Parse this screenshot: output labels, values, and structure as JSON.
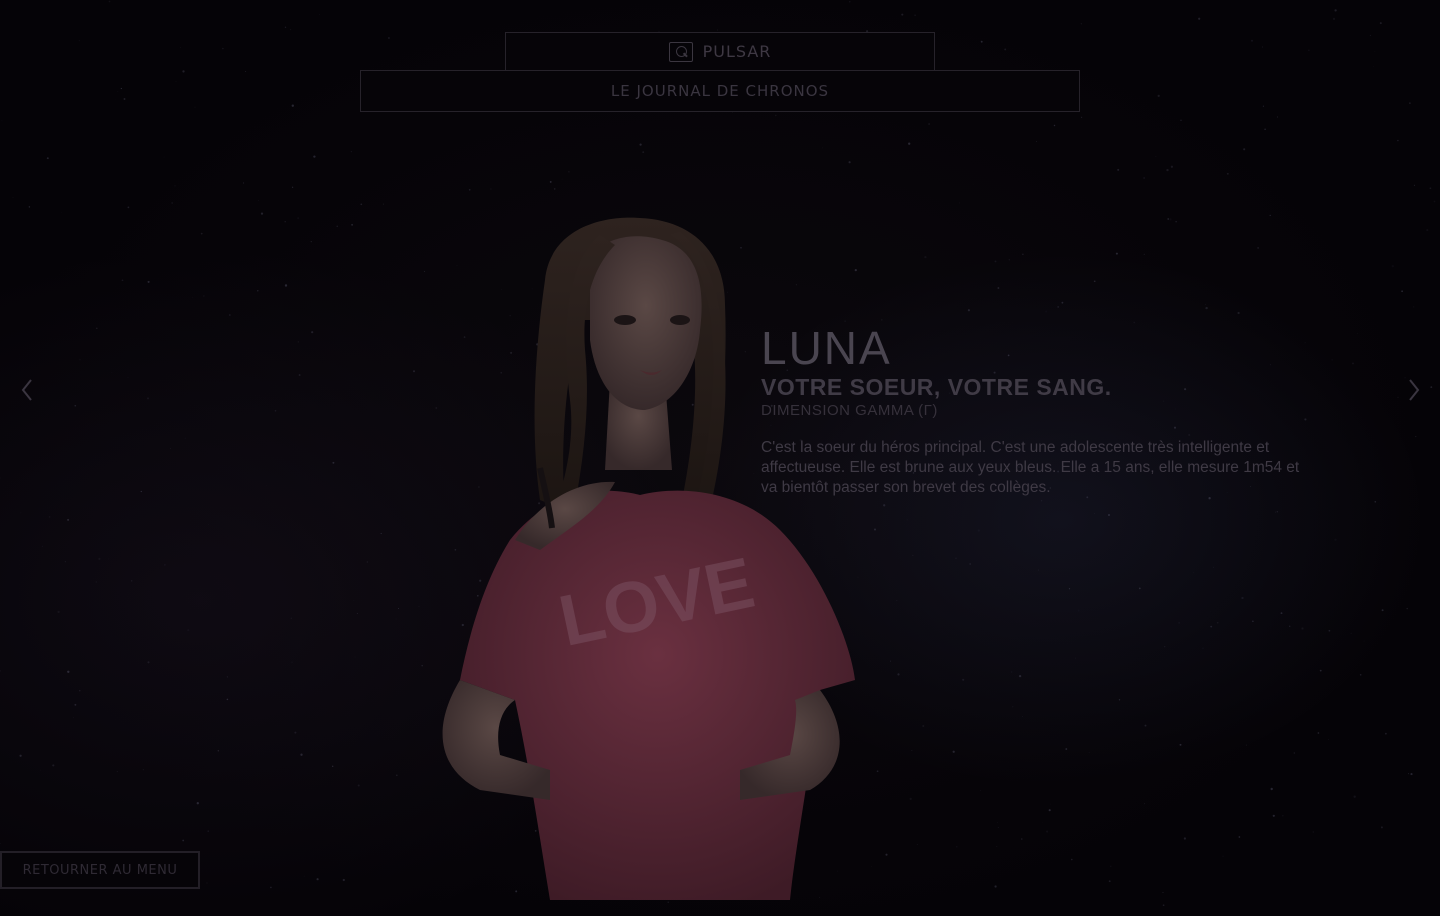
{
  "header": {
    "app_tab_label": "PULSAR",
    "app_tab_icon": "magnifier-window-icon",
    "section_title": "LE JOURNAL DE CHRONOS"
  },
  "navigation": {
    "prev_icon": "chevron-left-icon",
    "next_icon": "chevron-right-icon"
  },
  "character": {
    "name": "LUNA",
    "tagline": "VOTRE SOEUR, VOTRE SANG.",
    "dimension": "DIMENSION GAMMA (Γ)",
    "description": "C'est la soeur du héros principal. C'est une adolescente très intelligente et affectueuse. Elle est brune aux yeux bleus. Elle a 15 ans, elle mesure 1m54 et va bientôt passer son brevet des collèges.",
    "shirt_text": "LOVE"
  },
  "footer": {
    "menu_button_label": "RETOURNER AU MENU"
  },
  "colors": {
    "background": "#050307",
    "border": "#26222a",
    "text_dim": "#3f3a45",
    "shirt": "#5e2a38"
  }
}
